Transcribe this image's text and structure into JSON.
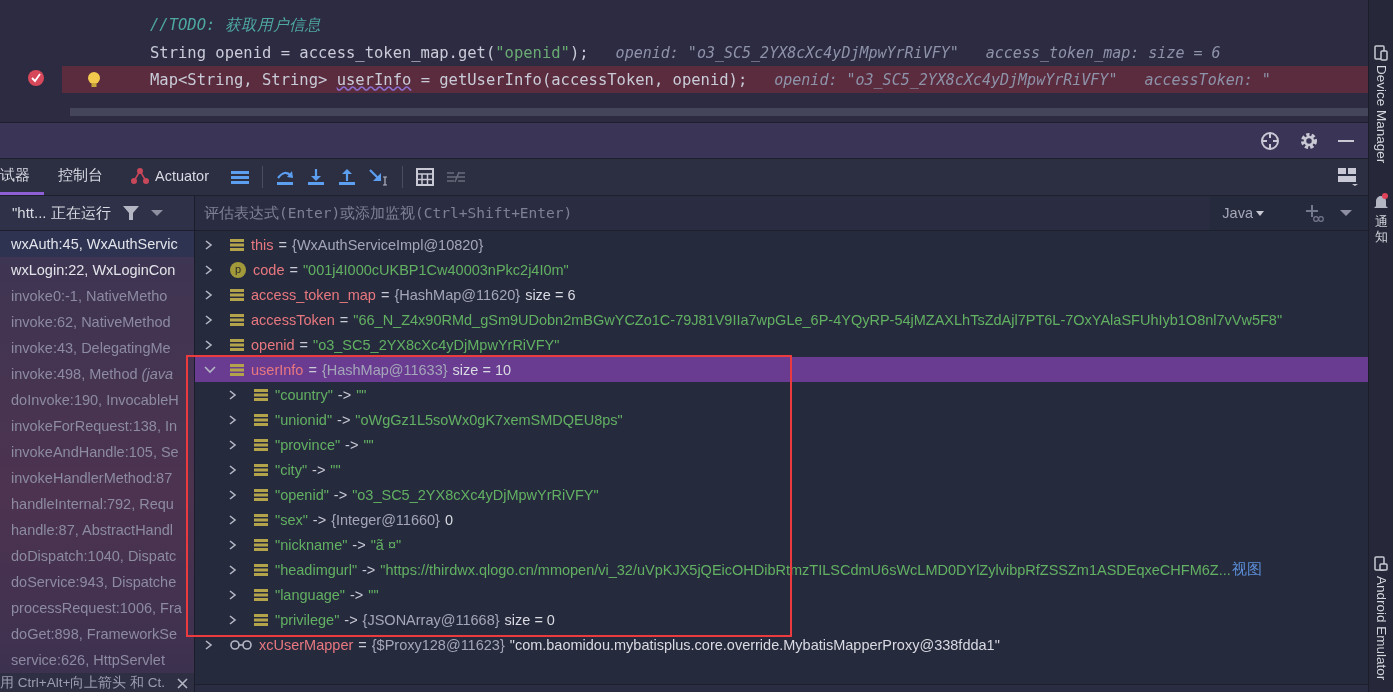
{
  "editor": {
    "lines": [
      {
        "highlighted": false,
        "breakpoint": false,
        "bulb": false,
        "segments": [
          {
            "kind": "comment",
            "text": "//TODO: 获取用户信息"
          }
        ]
      },
      {
        "highlighted": false,
        "breakpoint": false,
        "bulb": false,
        "segments": [
          {
            "kind": "plain",
            "text": "String openid = access_token_map.get("
          },
          {
            "kind": "string",
            "text": "\"openid\""
          },
          {
            "kind": "plain",
            "text": ");"
          }
        ],
        "hints": [
          "openid: \"o3_SC5_2YX8cXc4yDjMpwYrRiVFY\"",
          "access_token_map:  size = 6"
        ]
      },
      {
        "highlighted": true,
        "breakpoint": true,
        "bulb": true,
        "segments": [
          {
            "kind": "plain",
            "text": "Map<String, String> "
          },
          {
            "kind": "warning",
            "text": "userInfo"
          },
          {
            "kind": "plain",
            "text": " = getUserInfo(accessToken, openid);"
          }
        ],
        "hints": [
          "openid: \"o3_SC5_2YX8cXc4yDjMpwYrRiVFY\"",
          "accessToken: \""
        ]
      }
    ]
  },
  "tabs": [
    {
      "label": "试器",
      "kind": "plain",
      "selected": true
    },
    {
      "label": "控制台",
      "kind": "plain",
      "selected": false
    },
    {
      "label": "Actuator",
      "kind": "actuator",
      "selected": false
    }
  ],
  "thread": {
    "label": "\"htt... 正在运行"
  },
  "frames": [
    {
      "text": "wxAuth:45, WxAuthServic",
      "kind": "user",
      "selected": true
    },
    {
      "text": "wxLogin:22, WxLoginCon",
      "kind": "user",
      "selected": false
    },
    {
      "text": "invoke0:-1, NativeMetho",
      "kind": "library",
      "selected": false
    },
    {
      "text": "invoke:62, NativeMethod",
      "kind": "library",
      "selected": false
    },
    {
      "text": "invoke:43, DelegatingMe",
      "kind": "library",
      "selected": false
    },
    {
      "text": "invoke:498, Method *(java*",
      "kind": "library",
      "selected": false
    },
    {
      "text": "doInvoke:190, InvocableH",
      "kind": "library",
      "selected": false
    },
    {
      "text": "invokeForRequest:138, In",
      "kind": "library",
      "selected": false
    },
    {
      "text": "invokeAndHandle:105, Se",
      "kind": "library",
      "selected": false
    },
    {
      "text": "invokeHandlerMethod:87",
      "kind": "library",
      "selected": false
    },
    {
      "text": "handleInternal:792, Requ",
      "kind": "library",
      "selected": false
    },
    {
      "text": "handle:87, AbstractHandl",
      "kind": "library",
      "selected": false
    },
    {
      "text": "doDispatch:1040, Dispatc",
      "kind": "library",
      "selected": false
    },
    {
      "text": "doService:943, Dispatche",
      "kind": "library",
      "selected": false
    },
    {
      "text": "processRequest:1006, Fra",
      "kind": "library",
      "selected": false
    },
    {
      "text": "doGet:898, FrameworkSe",
      "kind": "library",
      "selected": false
    },
    {
      "text": "service:626, HttpServlet",
      "kind": "library",
      "selected": false
    }
  ],
  "frames_hint": "用 Ctrl+Alt+向上箭头 和 Ct.",
  "evaluate": {
    "placeholder": "评估表达式(Enter)或添加监视(Ctrl+Shift+Enter)"
  },
  "language": "Java",
  "variables": [
    {
      "kind": "field",
      "name": "this",
      "sep": "=",
      "type": "{WxAuthServiceImpl@10820}",
      "expanded": false,
      "selected": false,
      "outlined": false
    },
    {
      "kind": "param",
      "badge": "p",
      "name": "code",
      "sep": "=",
      "string": "\"001j4I000cUKBP1Cw40003nPkc2j4I0m\"",
      "expanded": false,
      "selected": false,
      "outlined": false
    },
    {
      "kind": "field",
      "name": "access_token_map",
      "sep": "=",
      "type": "{HashMap@11620}",
      "extra": "size = 6",
      "expanded": false,
      "selected": false,
      "outlined": false
    },
    {
      "kind": "field",
      "name": "accessToken",
      "sep": "=",
      "string": "\"66_N_Z4x90RMd_gSm9UDobn2mBGwYCZo1C-79J81V9IIa7wpGLe_6P-4YQyRP-54jMZAXLhTsZdAjl7PT6L-7OxYAlaSFUhIyb1O8nl7vVw5F8\"",
      "expanded": false,
      "selected": false,
      "outlined": false
    },
    {
      "kind": "field",
      "name": "openid",
      "sep": "=",
      "string": "\"o3_SC5_2YX8cXc4yDjMpwYrRiVFY\"",
      "expanded": false,
      "selected": false,
      "outlined": false
    },
    {
      "kind": "field",
      "name": "userInfo",
      "sep": "=",
      "type": "{HashMap@11633}",
      "extra": "size = 10",
      "expanded": true,
      "selected": true,
      "outlined": true,
      "children": [
        {
          "key": "\"country\"",
          "sep": "->",
          "string": "\"\"",
          "expanded": false
        },
        {
          "key": "\"unionid\"",
          "sep": "->",
          "string": "\"oWgGz1L5soWx0gK7xemSMDQEU8ps\"",
          "expanded": false
        },
        {
          "key": "\"province\"",
          "sep": "->",
          "string": "\"\"",
          "expanded": false
        },
        {
          "key": "\"city\"",
          "sep": "->",
          "string": "\"\"",
          "expanded": false
        },
        {
          "key": "\"openid\"",
          "sep": "->",
          "string": "\"o3_SC5_2YX8cXc4yDjMpwYrRiVFY\"",
          "expanded": false
        },
        {
          "key": "\"sex\"",
          "sep": "->",
          "type": "{Integer@11660}",
          "extra": "0",
          "expanded": false
        },
        {
          "key": "\"nickname\"",
          "sep": "->",
          "string": "\"ã  ¤\"",
          "expanded": false
        },
        {
          "key": "\"headimgurl\"",
          "sep": "->",
          "string": "\"https://thirdwx.qlogo.cn/mmopen/vi_32/uVpKJX5jQEicOHDibRtmzTILSCdmU6sWcLMD0DYlZylvibpRfZSSZm1ASDEqxeCHFM6Z...",
          "link": "视图",
          "expanded": false
        },
        {
          "key": "\"language\"",
          "sep": "->",
          "string": "\"\"",
          "expanded": false
        },
        {
          "key": "\"privilege\"",
          "sep": "->",
          "type": "{JSONArray@11668}",
          "extra": "size = 0",
          "expanded": false
        }
      ]
    },
    {
      "kind": "watch",
      "name": "xcUserMapper",
      "sep": "=",
      "type": "{$Proxy128@11623}",
      "extra": "\"com.baomidou.mybatisplus.core.override.MybatisMapperProxy@338fdda1\"",
      "expanded": false,
      "selected": false,
      "outlined": false
    }
  ],
  "side_strip": [
    {
      "label": "Device Manager",
      "kind": "device"
    },
    {
      "label": "通知",
      "kind": "notifications"
    },
    {
      "label": "Android Emulator",
      "kind": "emulator"
    }
  ]
}
